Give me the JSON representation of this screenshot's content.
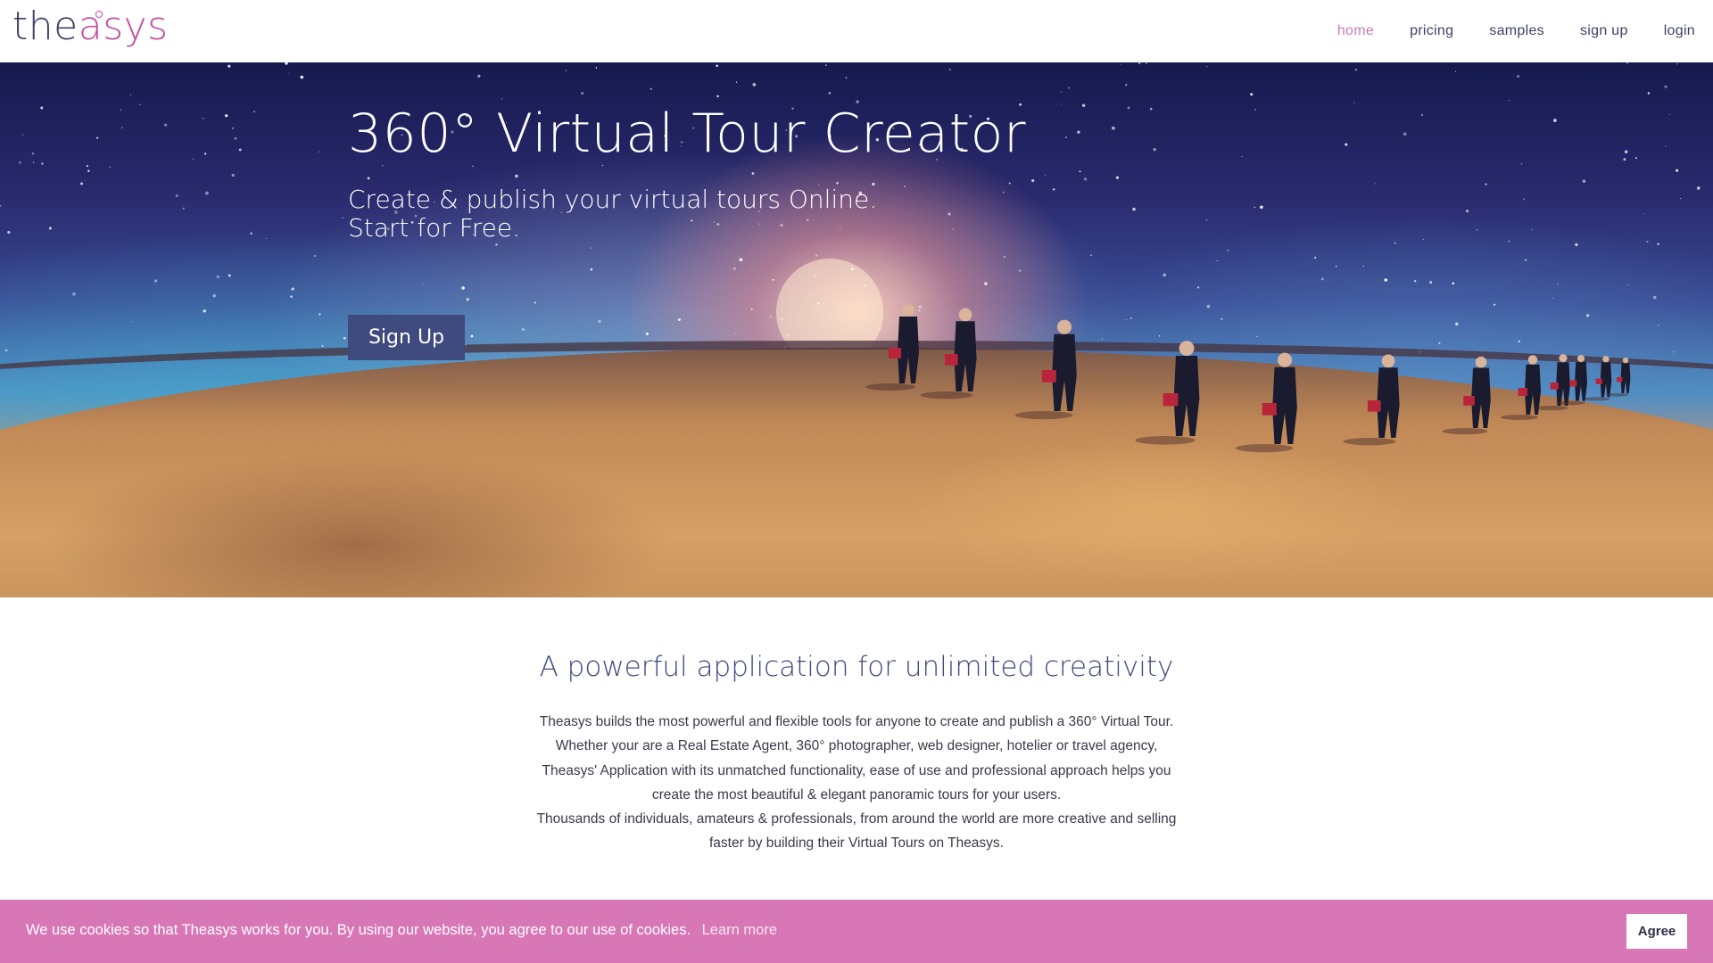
{
  "header": {
    "logo_left": "the",
    "logo_mid": "a",
    "logo_right": "sys",
    "nav": [
      {
        "label": "home",
        "active": true
      },
      {
        "label": "pricing"
      },
      {
        "label": "samples"
      },
      {
        "label": "sign up"
      },
      {
        "label": "login"
      }
    ]
  },
  "hero": {
    "title": "360° Virtual Tour Creator",
    "subtitle_line1": "Create & publish your virtual tours Online.",
    "subtitle_line2": "Start for Free.",
    "cta_label": "Sign Up"
  },
  "main": {
    "heading": "A powerful application for unlimited creativity",
    "paragraph_lines": [
      "Theasys builds the most powerful and flexible tools for anyone to create and publish a 360° Virtual Tour.",
      "Whether your are a Real Estate Agent, 360° photographer, web designer, hotelier or travel agency,",
      "Theasys' Application with its unmatched functionality, ease of use and professional approach helps you",
      "create the most beautiful & elegant panoramic tours for your users.",
      "Thousands of individuals, amateurs & professionals, from around the world are more creative and selling",
      "faster by building their Virtual Tours on Theasys."
    ]
  },
  "cookie": {
    "message": "We use cookies so that Theasys works for you. By using our website, you agree to our use of cookies.",
    "learn_more": "Learn more",
    "agree_label": "Agree"
  },
  "colors": {
    "brand_dark": "#3d4166",
    "brand_pink": "#c04f9e",
    "nav_active": "#c77bb4",
    "cta_bg": "#3f4a7e",
    "cookie_bg": "#d877b6"
  }
}
